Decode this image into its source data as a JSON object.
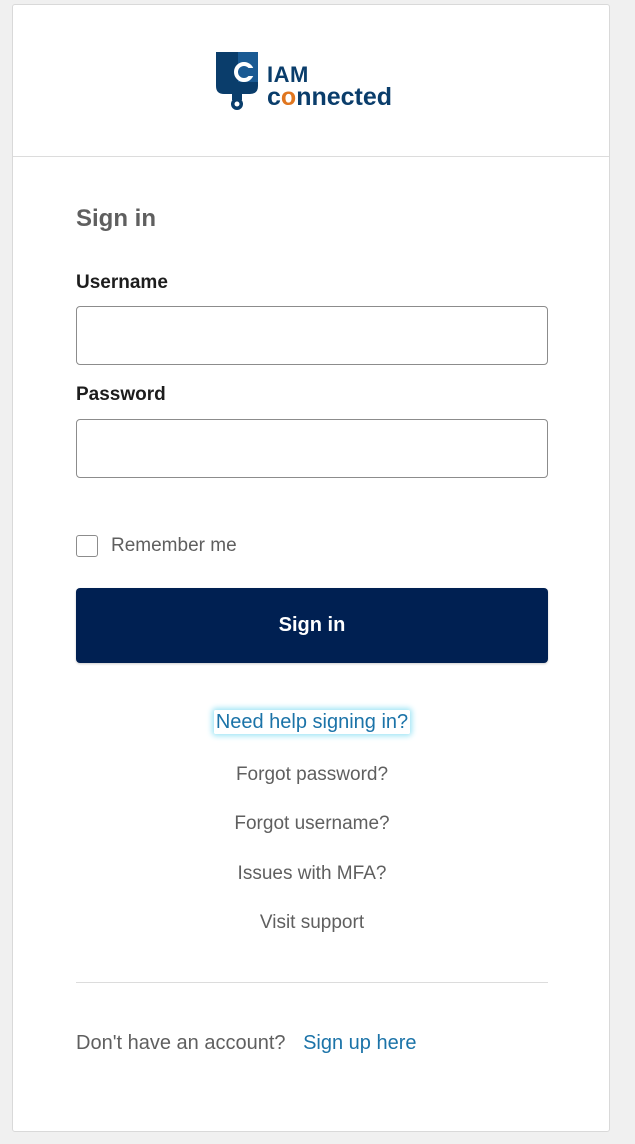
{
  "brand": {
    "logo_line1": "IAM",
    "logo_line2_prefix": "c",
    "logo_line2_accent": "o",
    "logo_line2_suffix": "nnected",
    "colors": {
      "primary": "#0a3d6b",
      "accent": "#e0761f",
      "button": "#002052",
      "link": "#1b73a8"
    }
  },
  "form": {
    "title": "Sign in",
    "username_label": "Username",
    "username_value": "",
    "password_label": "Password",
    "password_value": "",
    "remember_label": "Remember me",
    "remember_checked": false,
    "submit_label": "Sign in"
  },
  "help": {
    "title": "Need help signing in?",
    "links": [
      "Forgot password?",
      "Forgot username?",
      "Issues with MFA?",
      "Visit support"
    ]
  },
  "signup": {
    "prompt": "Don't have an account?",
    "link": "Sign up here"
  }
}
